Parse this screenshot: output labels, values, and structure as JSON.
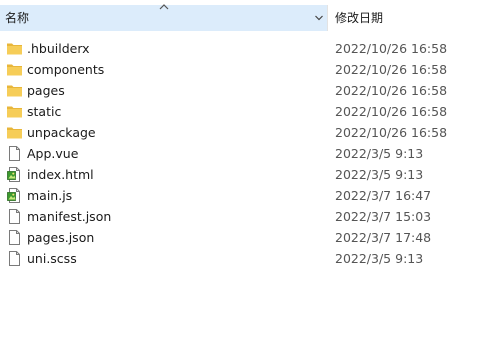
{
  "header": {
    "name_label": "名称",
    "date_label": "修改日期",
    "sort_icon": "sort-ascending-chevron",
    "dropdown_icon": "chevron-down-icon"
  },
  "colors": {
    "header_bg": "#dcecfb",
    "folder": "#e8b63a",
    "date_text": "#555555"
  },
  "files": [
    {
      "name": ".hbuilderx",
      "date": "2022/10/26 16:58",
      "type": "folder"
    },
    {
      "name": "components",
      "date": "2022/10/26 16:58",
      "type": "folder"
    },
    {
      "name": "pages",
      "date": "2022/10/26 16:58",
      "type": "folder"
    },
    {
      "name": "static",
      "date": "2022/10/26 16:58",
      "type": "folder"
    },
    {
      "name": "unpackage",
      "date": "2022/10/26 16:58",
      "type": "folder"
    },
    {
      "name": "App.vue",
      "date": "2022/3/5 9:13",
      "type": "file"
    },
    {
      "name": "index.html",
      "date": "2022/3/5 9:13",
      "type": "image-file"
    },
    {
      "name": "main.js",
      "date": "2022/3/7 16:47",
      "type": "image-file"
    },
    {
      "name": "manifest.json",
      "date": "2022/3/7 15:03",
      "type": "file"
    },
    {
      "name": "pages.json",
      "date": "2022/3/7 17:48",
      "type": "file"
    },
    {
      "name": "uni.scss",
      "date": "2022/3/5 9:13",
      "type": "file"
    }
  ]
}
